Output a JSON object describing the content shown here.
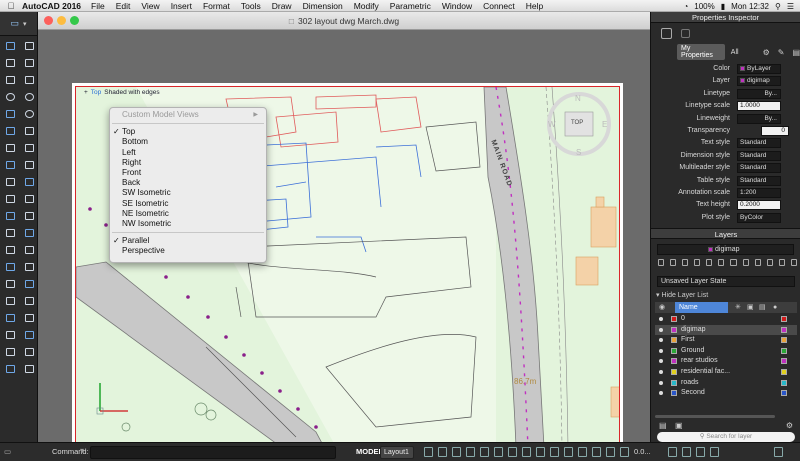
{
  "menubar": {
    "apple": "",
    "app": "AutoCAD 2016",
    "items": [
      "File",
      "Edit",
      "View",
      "Insert",
      "Format",
      "Tools",
      "Draw",
      "Dimension",
      "Modify",
      "Parametric",
      "Window",
      "Connect",
      "Help"
    ],
    "battery": "100%",
    "clock": "Mon 12:32"
  },
  "document": {
    "title": "302 layout dwg March.dwg"
  },
  "viewport": {
    "label_plus": "+",
    "label_view": "Top",
    "label_style": "Shaded with edges",
    "road_label": "MAIN ROAD",
    "elevation": "86.7m",
    "viewcube": {
      "n": "N",
      "s": "S",
      "e": "E",
      "w": "W",
      "face": "TOP"
    }
  },
  "view_menu": {
    "header": "Custom Model Views",
    "items": [
      {
        "label": "Top",
        "checked": true
      },
      {
        "label": "Bottom",
        "checked": false
      },
      {
        "label": "Left",
        "checked": false
      },
      {
        "label": "Right",
        "checked": false
      },
      {
        "label": "Front",
        "checked": false
      },
      {
        "label": "Back",
        "checked": false
      },
      {
        "label": "SW Isometric",
        "checked": false
      },
      {
        "label": "SE Isometric",
        "checked": false
      },
      {
        "label": "NE Isometric",
        "checked": false
      },
      {
        "label": "NW Isometric",
        "checked": false
      }
    ],
    "projection": [
      {
        "label": "Parallel",
        "checked": true
      },
      {
        "label": "Perspective",
        "checked": false
      }
    ]
  },
  "statusbar": {
    "command_label": "Command:",
    "model": "MODEL",
    "layout": "Layout1",
    "zoom": "0.0..."
  },
  "inspector": {
    "title": "Properties Inspector",
    "tabs": [
      "My Properties",
      "All"
    ],
    "props": [
      {
        "label": "Color",
        "value": "ByLayer",
        "swatch": "#c030c0"
      },
      {
        "label": "Layer",
        "value": "digimap"
      },
      {
        "label": "Linetype",
        "value": "By..."
      },
      {
        "label": "Linetype scale",
        "value": "1.0000"
      },
      {
        "label": "Lineweight",
        "value": "By..."
      },
      {
        "label": "Transparency",
        "value": "0"
      },
      {
        "label": "Text style",
        "value": "Standard"
      },
      {
        "label": "Dimension style",
        "value": "Standard"
      },
      {
        "label": "Multileader style",
        "value": "Standard"
      },
      {
        "label": "Table style",
        "value": "Standard"
      },
      {
        "label": "Annotation scale",
        "value": "1:200"
      },
      {
        "label": "Text height",
        "value": "0.2000"
      },
      {
        "label": "Plot style",
        "value": "ByColor"
      }
    ]
  },
  "layers": {
    "title": "Layers",
    "current": "digimap",
    "state": "Unsaved Layer State",
    "hide_list": "Hide Layer List",
    "name_header": "Name",
    "rows": [
      {
        "name": "0",
        "color": "#d11b1b"
      },
      {
        "name": "digimap",
        "color": "#c030c0",
        "selected": true
      },
      {
        "name": "First",
        "color": "#e8a23a"
      },
      {
        "name": "Ground",
        "color": "#2aa838"
      },
      {
        "name": "rear studios",
        "color": "#c030c0"
      },
      {
        "name": "residential fac...",
        "color": "#e0d020"
      },
      {
        "name": "roads",
        "color": "#27b8c9"
      },
      {
        "name": "Second",
        "color": "#2a56c8"
      }
    ],
    "search_placeholder": "Search for layer"
  }
}
